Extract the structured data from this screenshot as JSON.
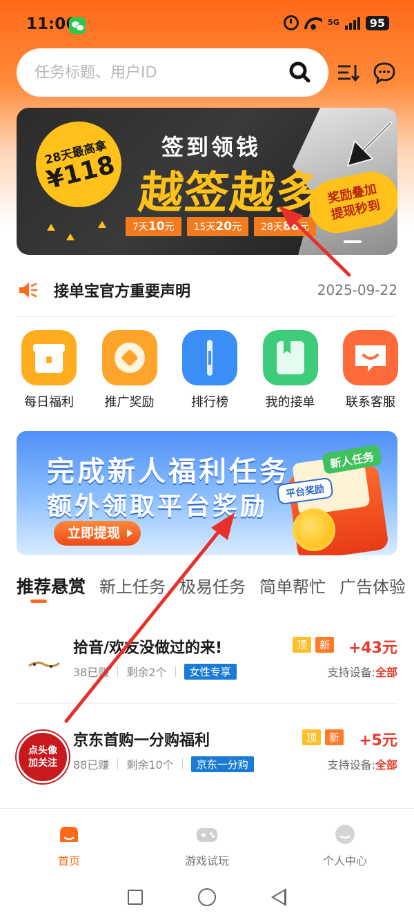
{
  "status_bar": {
    "time": "11:06",
    "signal_label": "5G",
    "battery": "95"
  },
  "search": {
    "placeholder": "任务标题、用户ID"
  },
  "banner1": {
    "circle_line1": "28天最高拿",
    "circle_line2": "¥118",
    "subtitle": "签到领钱",
    "title": "越签越多",
    "chips": [
      {
        "pre": "7天",
        "amount": "10",
        "unit": "元"
      },
      {
        "pre": "15天",
        "amount": "20",
        "unit": "元"
      },
      {
        "pre": "28天",
        "amount": "88",
        "unit": "元"
      }
    ],
    "badge_line1": "奖励叠加",
    "badge_line2": "提现秒到"
  },
  "notice": {
    "title": "接单宝官方重要声明",
    "date": "2025-09-22"
  },
  "quick_items": [
    {
      "label": "每日福利",
      "icon": "gift-icon",
      "color": "#ffad1f"
    },
    {
      "label": "推广奖励",
      "icon": "coin-icon",
      "color": "#ffa42a"
    },
    {
      "label": "排行榜",
      "icon": "ranking-icon",
      "color": "#3a8ef6"
    },
    {
      "label": "我的接单",
      "icon": "book-icon",
      "color": "#3ecb7a"
    },
    {
      "label": "联系客服",
      "icon": "service-icon",
      "color": "#ff6a3a"
    }
  ],
  "banner2": {
    "line1": "完成新人福利任务",
    "line2": "额外领取平台奖励",
    "button": "立即提现",
    "tag1": "新人任务",
    "tag2": "平台奖励"
  },
  "tabs": [
    "推荐悬赏",
    "新上任务",
    "极易任务",
    "简单帮忙",
    "广告体验"
  ],
  "tasks": [
    {
      "title": "拾音/欢友没做过的来!",
      "earned": "38已赚",
      "remaining": "剩余2个",
      "badge": "女性专享",
      "tag_top": "顶",
      "tag_new": "新",
      "reward": "+43元",
      "device_label": "支持设备:",
      "device_value": "全部"
    },
    {
      "title": "京东首购一分购福利",
      "earned": "88已赚",
      "remaining": "剩余10个",
      "badge": "京东一分购",
      "tag_top": "顶",
      "tag_new": "新",
      "reward": "+5元",
      "device_label": "支持设备:",
      "device_value": "全部",
      "thumb_text_line1": "点头像",
      "thumb_text_line2": "加关注"
    }
  ],
  "bottom_nav": [
    {
      "label": "首页",
      "icon": "home-icon",
      "active": true
    },
    {
      "label": "游戏试玩",
      "icon": "gamepad-icon",
      "active": false
    },
    {
      "label": "个人中心",
      "icon": "profile-icon",
      "active": false
    }
  ],
  "colors": {
    "accent": "#ff6a1a",
    "reward": "#e83b2b",
    "annotation": "#e8302a"
  }
}
